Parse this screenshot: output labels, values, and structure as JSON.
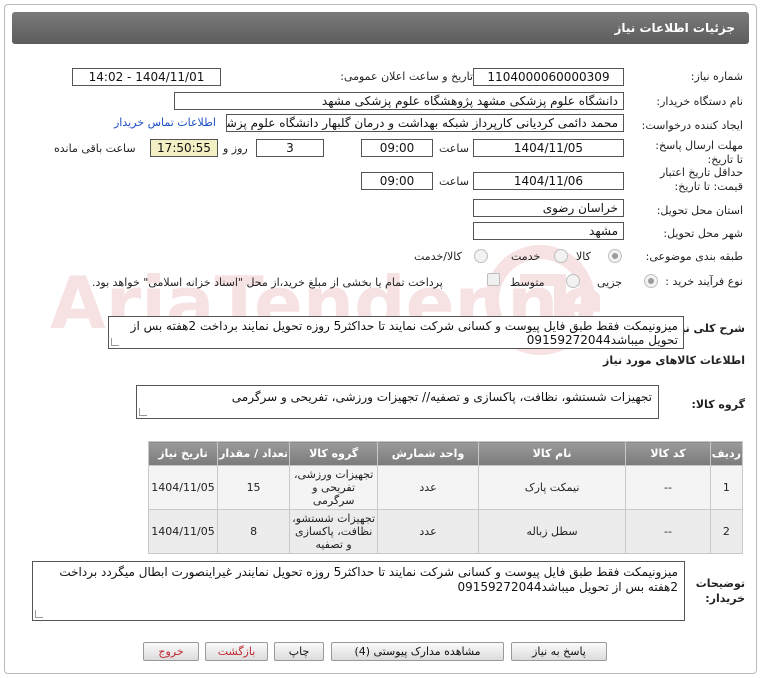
{
  "header": {
    "title": "جزئیات اطلاعات نیاز"
  },
  "fields": {
    "need_number_label": "شماره نیاز:",
    "need_number": "1104000060000309",
    "announce_label": "تاریخ و ساعت اعلان عمومی:",
    "announce_value": "1404/11/01 - 14:02",
    "buyer_label": "نام دستگاه خریدار:",
    "buyer_value": "دانشگاه علوم پزشکی مشهد   پژوهشگاه علوم پزشکی مشهد",
    "requester_label": "ایجاد کننده درخواست:",
    "requester_value": "محمد دائمی کردیانی کارپرداز شبکه بهداشت و درمان گلبهار دانشگاه علوم پزشکی",
    "contact_link": "اطلاعات تماس خریدار",
    "deadline_label": "مهلت ارسال پاسخ: تا تاریخ:",
    "deadline_date": "1404/11/05",
    "time_label": "ساعت",
    "deadline_time": "09:00",
    "days_value": "3",
    "days_label": "روز و",
    "remaining_time": "17:50:55",
    "remaining_label": "ساعت باقی مانده",
    "validity_label": "حداقل تاریخ اعتبار قیمت: تا تاریخ:",
    "validity_date": "1404/11/06",
    "validity_time": "09:00",
    "province_label": "استان محل تحویل:",
    "province_value": "خراسان رضوی",
    "city_label": "شهر محل تحویل:",
    "city_value": "مشهد",
    "category_label": "طبقه بندی موضوعی:",
    "category_options": [
      "کالا",
      "خدمت",
      "کالا/خدمت"
    ],
    "process_label": "نوع فرآیند خرید :",
    "process_options": [
      "جزیی",
      "متوسط"
    ],
    "payment_text": "پرداخت تمام یا بخشی از مبلغ خرید،از محل \"اسناد خزانه اسلامی\" خواهد بود."
  },
  "description": {
    "label": "شرح کلی نیاز:",
    "text": "میزونیمکت فقط طبق فایل پیوست و کسانی شرکت نمایند تا حداکثر5 روزه تحویل نمایند برداخت 2هفته بس از تحویل میباشد09159272044"
  },
  "goods_section": {
    "title": "اطلاعات کالاهای مورد نیاز"
  },
  "goods_group": {
    "label": "گروه کالا:",
    "text": "تجهیزات شستشو، نظافت، پاکسازی و تصفیه// تجهیزات ورزشی، تفریحی و سرگرمی"
  },
  "table": {
    "headers": [
      "ردیف",
      "کد کالا",
      "نام کالا",
      "واحد شمارش",
      "گروه کالا",
      "تعداد / مقدار",
      "تاریخ نیاز"
    ],
    "rows": [
      {
        "index": "1",
        "code": "--",
        "name": "نیمکت پارک",
        "unit": "عدد",
        "group": "تجهیزات ورزشی، تفریحی و سرگرمی",
        "qty": "15",
        "date": "1404/11/05"
      },
      {
        "index": "2",
        "code": "--",
        "name": "سطل زباله",
        "unit": "عدد",
        "group": "تجهیزات شستشو، نظافت، پاکسازی و تصفیه",
        "qty": "8",
        "date": "1404/11/05"
      }
    ]
  },
  "buyer_notes": {
    "label": "توضیحات خریدار:",
    "text": "میزونیمکت فقط طبق فایل پیوست و کسانی شرکت نمایند تا حداکثر5 روزه تحویل نمایندر غیراینصورت ابطال میگردد برداخت 2هفته بس از تحویل میباشد09159272044"
  },
  "buttons": {
    "reply": "پاسخ به نیاز",
    "attachments": "مشاهده مدارک پیوستی (4)",
    "print": "چاپ",
    "back": "بازگشت",
    "exit": "خروج"
  },
  "watermark": {
    "text": "AriaTender.neT"
  },
  "colors": {
    "header": "#666666",
    "link": "#1a4fc8",
    "remaining_bg": "#f3efc4",
    "danger": "#c0262d"
  }
}
